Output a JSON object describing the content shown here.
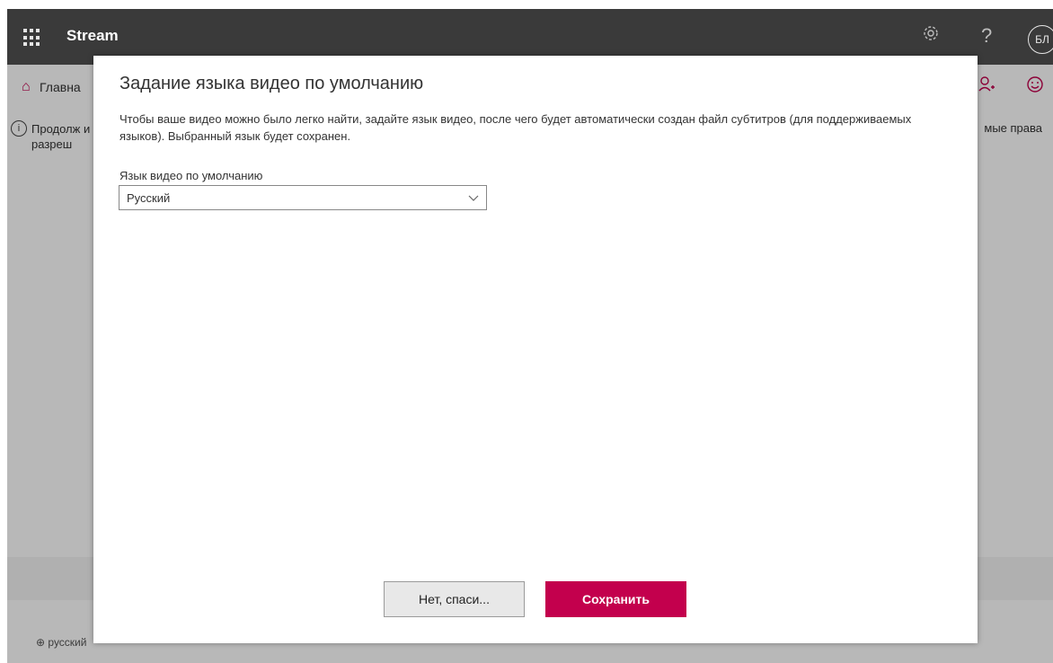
{
  "app": {
    "name": "Stream",
    "user_initials": "БЛ"
  },
  "topbar": {
    "settings_icon": "gear-icon",
    "help_glyph": "?"
  },
  "nav": {
    "home_label": "Главна"
  },
  "info": {
    "left_text": "Продолж и разреш",
    "right_text": "мые права"
  },
  "footer": {
    "language": "русский"
  },
  "dialog": {
    "title": "Задание языка видео по умолчанию",
    "description": "Чтобы ваше видео можно было легко найти, задайте язык видео, после чего будет автоматически создан файл субтитров (для поддерживаемых языков). Выбранный язык будет сохранен.",
    "field_label": "Язык видео по умолчанию",
    "selected_language": "Русский",
    "cancel_label": "Нет, спаси...",
    "save_label": "Сохранить"
  },
  "colors": {
    "accent": "#c3004d",
    "topbar": "#3a3a3a"
  }
}
